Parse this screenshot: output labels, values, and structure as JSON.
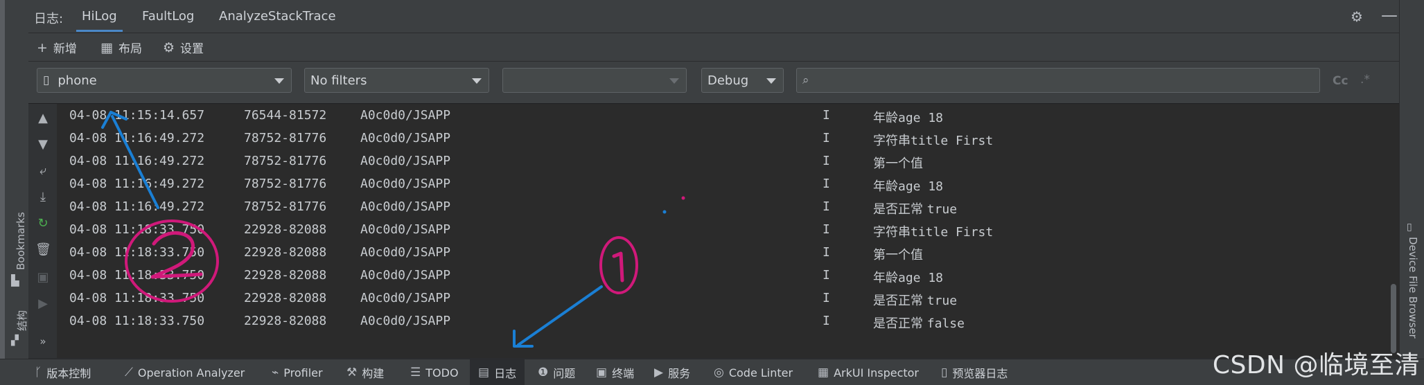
{
  "tool_window": {
    "title": "日志:",
    "tabs": [
      {
        "label": "HiLog",
        "active": true
      },
      {
        "label": "FaultLog",
        "active": false
      },
      {
        "label": "AnalyzeStackTrace",
        "active": false
      }
    ]
  },
  "actions": [
    {
      "label": "新增",
      "icon": "plus-icon"
    },
    {
      "label": "布局",
      "icon": "layout-grid-icon"
    },
    {
      "label": "设置",
      "icon": "gear-icon"
    }
  ],
  "filters": {
    "device": "phone",
    "filter": "No filters",
    "process": "",
    "level": "Debug",
    "search_value": "",
    "case_toggle": "Cc",
    "regex_toggle": ".*"
  },
  "log_lines": [
    {
      "time": "04-08 11:15:14.657",
      "pid": "76544-81572",
      "tag": "A0c0d0/JSAPP",
      "level": "I",
      "msg_cn": "年龄",
      "msg_en": "age 18"
    },
    {
      "time": "04-08 11:16:49.272",
      "pid": "78752-81776",
      "tag": "A0c0d0/JSAPP",
      "level": "I",
      "msg_cn": "字符串",
      "msg_en": "title First"
    },
    {
      "time": "04-08 11:16:49.272",
      "pid": "78752-81776",
      "tag": "A0c0d0/JSAPP",
      "level": "I",
      "msg_cn": "第一个值",
      "msg_en": ""
    },
    {
      "time": "04-08 11:16:49.272",
      "pid": "78752-81776",
      "tag": "A0c0d0/JSAPP",
      "level": "I",
      "msg_cn": "年龄",
      "msg_en": "age 18"
    },
    {
      "time": "04-08 11:16:49.272",
      "pid": "78752-81776",
      "tag": "A0c0d0/JSAPP",
      "level": "I",
      "msg_cn": "是否正常 ",
      "msg_en": "true"
    },
    {
      "time": "04-08 11:18:33.750",
      "pid": "22928-82088",
      "tag": "A0c0d0/JSAPP",
      "level": "I",
      "msg_cn": "字符串",
      "msg_en": "title First"
    },
    {
      "time": "04-08 11:18:33.750",
      "pid": "22928-82088",
      "tag": "A0c0d0/JSAPP",
      "level": "I",
      "msg_cn": "第一个值",
      "msg_en": ""
    },
    {
      "time": "04-08 11:18:33.750",
      "pid": "22928-82088",
      "tag": "A0c0d0/JSAPP",
      "level": "I",
      "msg_cn": "年龄",
      "msg_en": "age 18"
    },
    {
      "time": "04-08 11:18:33.750",
      "pid": "22928-82088",
      "tag": "A0c0d0/JSAPP",
      "level": "I",
      "msg_cn": "是否正常 ",
      "msg_en": "true"
    },
    {
      "time": "04-08 11:18:33.750",
      "pid": "22928-82088",
      "tag": "A0c0d0/JSAPP",
      "level": "I",
      "msg_cn": "是否正常 ",
      "msg_en": "false"
    }
  ],
  "side_panels": {
    "left_bookmarks": "Bookmarks",
    "left_structure": "结构",
    "right_device_browser": "Device File Browser"
  },
  "bottom_tabs": [
    {
      "label": "版本控制",
      "icon": "branch-icon",
      "active": false
    },
    {
      "label": "Operation Analyzer",
      "icon": "chart-line-icon",
      "active": false
    },
    {
      "label": "Profiler",
      "icon": "profiler-icon",
      "active": false
    },
    {
      "label": "构建",
      "icon": "hammer-icon",
      "active": false
    },
    {
      "label": "TODO",
      "icon": "list-icon",
      "active": false
    },
    {
      "label": "日志",
      "icon": "calendar-icon",
      "active": true
    },
    {
      "label": "问题",
      "icon": "warning-icon",
      "active": false
    },
    {
      "label": "终端",
      "icon": "terminal-icon",
      "active": false
    },
    {
      "label": "服务",
      "icon": "play-circle-icon",
      "active": false
    },
    {
      "label": "Code Linter",
      "icon": "linter-icon",
      "active": false
    },
    {
      "label": "ArkUI Inspector",
      "icon": "inspector-icon",
      "active": false
    },
    {
      "label": "预览器日志",
      "icon": "doc-icon",
      "active": false
    }
  ],
  "annotations": {
    "label_1": "1",
    "label_2": "2",
    "arrow_color": "#1a7fd4",
    "circle_color": "#d0197a"
  },
  "watermark": "CSDN @临境至清",
  "colors": {
    "accent": "#4a88c7",
    "panel": "#3c3f41",
    "editor": "#2b2b2b"
  }
}
